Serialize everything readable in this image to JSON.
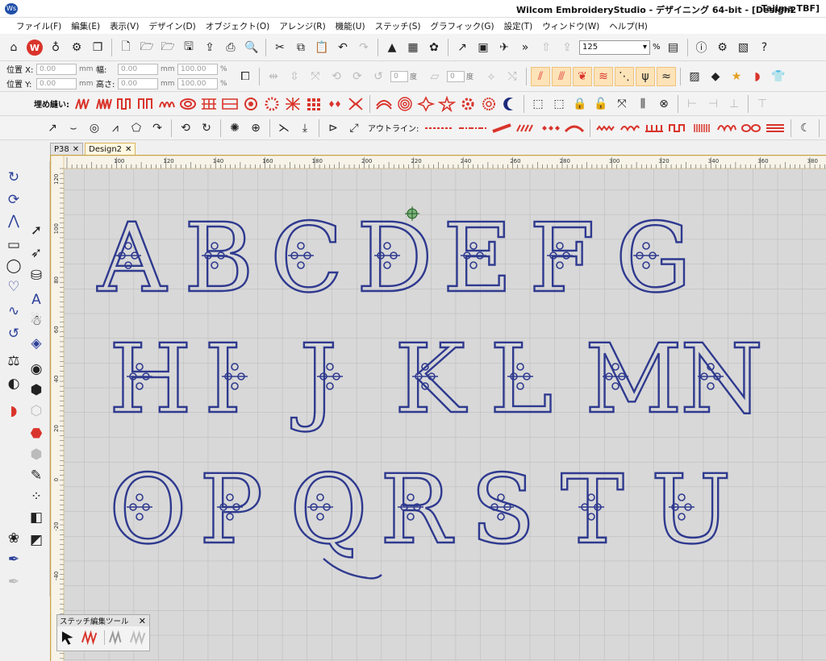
{
  "app": {
    "title": "Wilcom EmbroideryStudio - デザイニング 64-bit - [Design2",
    "user": "Tajima TBF]",
    "logo": "Ws"
  },
  "menu": [
    "ファイル(F)",
    "編集(E)",
    "表示(V)",
    "デザイン(D)",
    "オブジェクト(O)",
    "アレンジ(R)",
    "機能(U)",
    "ステッチ(S)",
    "グラフィック(G)",
    "設定(T)",
    "ウィンドウ(W)",
    "ヘルプ(H)"
  ],
  "toolbar": {
    "zoom_value": "125",
    "zoom_unit": "%",
    "zoom_arrow": "▾"
  },
  "position": {
    "x_label": "位置 X:",
    "y_label": "位置 Y:",
    "x_value": "0.00",
    "y_value": "0.00",
    "unit": "mm",
    "width_label": "幅:",
    "height_label": "高さ:",
    "width_value": "0.00",
    "height_value": "0.00",
    "width_pct": "100.00",
    "height_pct": "100.00",
    "pct_unit": "%",
    "rotate_value": "0",
    "slant_value": "0",
    "deg_unit": "度"
  },
  "fill_label": "埋め縫い:",
  "outline_label": "アウトライン:",
  "tabs": [
    {
      "label": "P38",
      "close": "✕"
    },
    {
      "label": "Design2",
      "close": "✕"
    }
  ],
  "ruler_top_ticks": [
    "100",
    "120",
    "140",
    "160",
    "180",
    "200",
    "220",
    "240",
    "260",
    "280",
    "300",
    "320",
    "340",
    "360",
    "380"
  ],
  "ruler_left_ticks": [
    "120",
    "100",
    "80",
    "60",
    "40",
    "20",
    "0",
    "-20",
    "-40"
  ],
  "letters": [
    "A",
    "B",
    "C",
    "D",
    "E",
    "F",
    "G",
    "H",
    "I",
    "J",
    "K",
    "L",
    "M",
    "N",
    "O",
    "P",
    "Q",
    "R",
    "S",
    "T",
    "U"
  ],
  "palette": {
    "title": "ステッチ編集ツール",
    "close": "✕"
  },
  "colors": {
    "thread": "#2f3a8f",
    "grid": "#bdbdbd",
    "accent": "#d9342b",
    "canvas": "#d8d8d8"
  }
}
